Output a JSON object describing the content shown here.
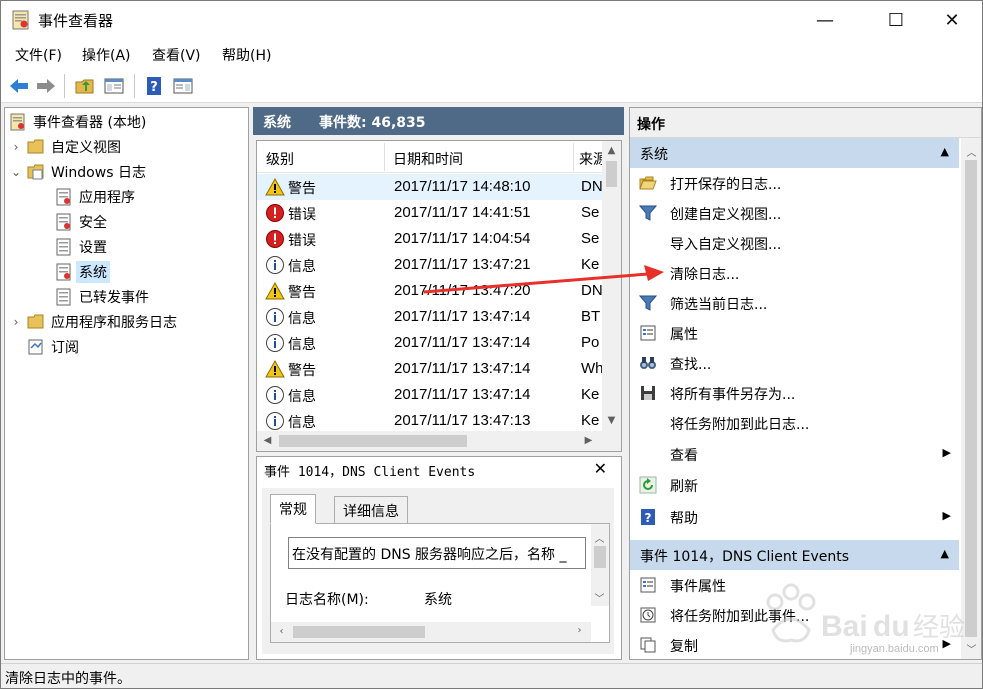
{
  "window": {
    "title": "事件查看器",
    "minimize": "—",
    "maximize": "☐",
    "close": "✕"
  },
  "menu": [
    "文件(F)",
    "操作(A)",
    "查看(V)",
    "帮助(H)"
  ],
  "tree": {
    "root": "事件查看器 (本地)",
    "custom_views": "自定义视图",
    "windows_logs": "Windows 日志",
    "application": "应用程序",
    "security": "安全",
    "setup": "设置",
    "system": "系统",
    "forwarded": "已转发事件",
    "app_service_logs": "应用程序和服务日志",
    "subscriptions": "订阅"
  },
  "log_header": {
    "name": "系统",
    "count": "事件数: 46,835"
  },
  "events": {
    "columns": [
      "级别",
      "日期和时间",
      "来源"
    ],
    "rows": [
      {
        "level": "警告",
        "type": "warning",
        "datetime": "2017/11/17 14:48:10",
        "source": "DN"
      },
      {
        "level": "错误",
        "type": "error",
        "datetime": "2017/11/17 14:41:51",
        "source": "Se"
      },
      {
        "level": "错误",
        "type": "error",
        "datetime": "2017/11/17 14:04:54",
        "source": "Se"
      },
      {
        "level": "信息",
        "type": "info",
        "datetime": "2017/11/17 13:47:21",
        "source": "Ke"
      },
      {
        "level": "警告",
        "type": "warning",
        "datetime": "2017/11/17 13:47:20",
        "source": "DN"
      },
      {
        "level": "信息",
        "type": "info",
        "datetime": "2017/11/17 13:47:14",
        "source": "BT"
      },
      {
        "level": "信息",
        "type": "info",
        "datetime": "2017/11/17 13:47:14",
        "source": "Po"
      },
      {
        "level": "警告",
        "type": "warning",
        "datetime": "2017/11/17 13:47:14",
        "source": "Wh"
      },
      {
        "level": "信息",
        "type": "info",
        "datetime": "2017/11/17 13:47:14",
        "source": "Ke"
      },
      {
        "level": "信息",
        "type": "info",
        "datetime": "2017/11/17 13:47:13",
        "source": "Ke"
      }
    ]
  },
  "detail": {
    "title": "事件 1014，DNS Client Events",
    "close": "✕",
    "tab_general": "常规",
    "tab_details": "详细信息",
    "message": "在没有配置的 DNS 服务器响应之后，名称 _",
    "log_name_label": "日志名称(M):",
    "log_name_value": "系统"
  },
  "actions": {
    "header": "操作",
    "group_system": "系统",
    "open_saved": "打开保存的日志...",
    "create_custom": "创建自定义视图...",
    "import_custom": "导入自定义视图...",
    "clear_log": "清除日志...",
    "filter_log": "筛选当前日志...",
    "properties": "属性",
    "find": "查找...",
    "save_all": "将所有事件另存为...",
    "attach_task": "将任务附加到此日志...",
    "view": "查看",
    "refresh": "刷新",
    "help": "帮助",
    "group_event": "事件 1014，DNS Client Events",
    "event_props": "事件属性",
    "attach_task_event": "将任务附加到此事件...",
    "copy": "复制"
  },
  "status": "清除日志中的事件。",
  "watermark": {
    "brand": "Baidu经验",
    "url": "jingyan.baidu.com"
  },
  "colors": {
    "header_blue": "#4e6a87",
    "group_blue": "#c7d9ec",
    "selection": "#cce8ff",
    "arrow_red": "#e8302a"
  }
}
